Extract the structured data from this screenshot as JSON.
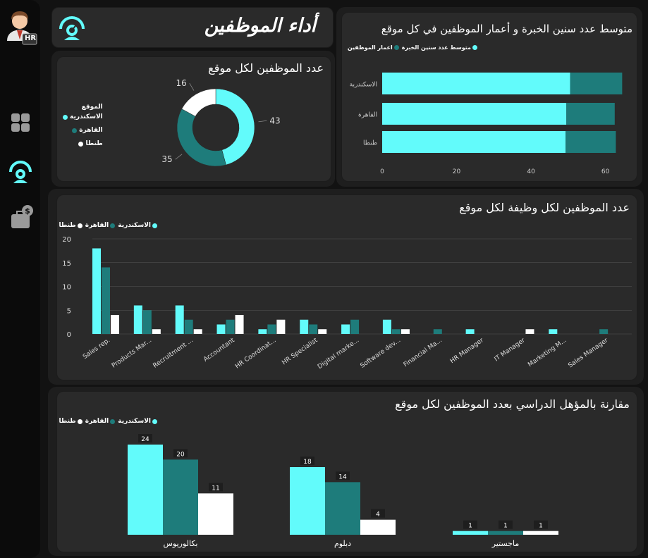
{
  "app": {
    "title": "أداء الموظفين",
    "hr_badge": "HR"
  },
  "colors": {
    "alexandria": "#62fbfb",
    "cairo": "#1e7c7b",
    "tanta": "#ffffff",
    "card": "#2a2a2a"
  },
  "nav": {
    "items": [
      {
        "icon": "dashboard-grid-icon"
      },
      {
        "icon": "performance-gauge-icon"
      },
      {
        "icon": "salary-briefcase-icon"
      }
    ]
  },
  "chart_data": [
    {
      "type": "pie",
      "title": "عدد الموظفين لكل موقع",
      "legend_title": "الموقع",
      "categories": [
        "الاسكندرية",
        "القاهرة",
        "طنطا"
      ],
      "values": [
        43,
        35,
        16
      ],
      "legend_position": "left"
    },
    {
      "type": "bar",
      "orientation": "horizontal",
      "stacked": true,
      "title": "متوسط عدد سنين الخبرة و أعمار الموظفين في كل موقع",
      "categories": [
        "الاسكندرية",
        "القاهرة",
        "طنطا"
      ],
      "series": [
        {
          "name": "متوسط عدد سنين الخبرة",
          "values": [
            50.5,
            49.5,
            49.3
          ]
        },
        {
          "name": "اعمار الموظفين",
          "values": [
            14,
            13,
            13.5
          ]
        }
      ],
      "xlim": [
        0,
        65
      ],
      "xticks": [
        0,
        20,
        40,
        60
      ],
      "legend_position": "top-right"
    },
    {
      "type": "bar",
      "title": "عدد الموظفين لكل وظيفة لكل موقع",
      "categories": [
        "Sales rep.",
        "Products Mar...",
        "Recruitment ...",
        "Accountant",
        "HR Coordinat...",
        "HR Specialist",
        "Digital marke...",
        "Software dev...",
        "Financial Ma...",
        "HR Manager",
        "IT Manager",
        "Marketing M...",
        "Sales Manager"
      ],
      "series": [
        {
          "name": "الاسكندرية",
          "values": [
            18,
            6,
            6,
            2,
            1,
            3,
            2,
            3,
            0,
            1,
            0,
            1,
            0
          ]
        },
        {
          "name": "القاهرة",
          "values": [
            14,
            5,
            3,
            3,
            2,
            2,
            3,
            1,
            1,
            0,
            0,
            0,
            1
          ]
        },
        {
          "name": "طنطا",
          "values": [
            4,
            1,
            1,
            4,
            3,
            1,
            0,
            1,
            0,
            0,
            1,
            0,
            0
          ]
        }
      ],
      "ylim": [
        0,
        20
      ],
      "yticks": [
        0,
        5,
        10,
        15,
        20
      ],
      "grid": true,
      "legend_position": "top-right"
    },
    {
      "type": "bar",
      "title": "مقارنة بالمؤهل الدراسي بعدد الموظفين لكل موقع",
      "categories": [
        "بكالوريوس",
        "دبلوم",
        "ماجستير"
      ],
      "series": [
        {
          "name": "الاسكندرية",
          "values": [
            24,
            18,
            1
          ]
        },
        {
          "name": "القاهرة",
          "values": [
            20,
            14,
            1
          ]
        },
        {
          "name": "طنطا",
          "values": [
            11,
            4,
            1
          ]
        }
      ],
      "data_labels": true,
      "legend_position": "top-right"
    }
  ]
}
